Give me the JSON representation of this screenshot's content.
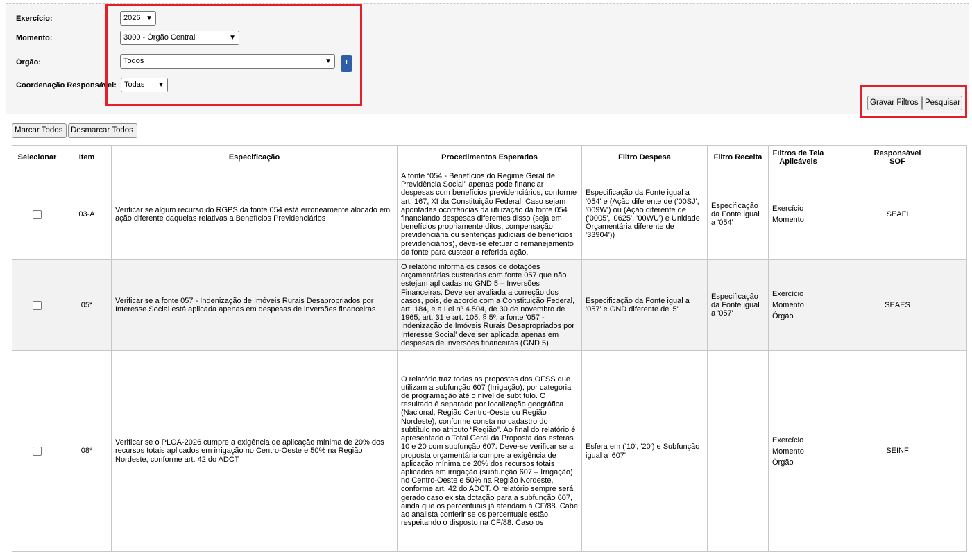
{
  "filters": {
    "exercicio": {
      "label": "Exercício:",
      "value": "2026"
    },
    "momento": {
      "label": "Momento:",
      "value": "3000 - Órgão Central"
    },
    "orgao": {
      "label": "Órgão:",
      "value": "Todos",
      "add_label": "+"
    },
    "coordenacao": {
      "label": "Coordenação Responsável:",
      "value": "Todas"
    }
  },
  "actions": {
    "gravar": "Gravar Filtros",
    "pesquisar": "Pesquisar",
    "marcar_todos": "Marcar Todos",
    "desmarcar_todos": "Desmarcar Todos"
  },
  "table": {
    "headers": {
      "selecionar": "Selecionar",
      "item": "Item",
      "especificacao": "Especificação",
      "procedimentos": "Procedimentos Esperados",
      "filtro_despesa": "Filtro Despesa",
      "filtro_receita": "Filtro Receita",
      "filtros_tela_1": "Filtros de Tela",
      "filtros_tela_2": "Aplicáveis",
      "responsavel_1": "Responsável",
      "responsavel_2": "SOF"
    },
    "rows": [
      {
        "item": "03-A",
        "especificacao": "Verificar se algum recurso do RGPS da fonte 054 está erroneamente alocado em ação diferente daquelas relativas a Benefícios Previdenciários",
        "procedimentos": "A fonte “054 - Benefícios do Regime Geral de Previdência Social” apenas pode financiar despesas com benefícios previdenciários, conforme art. 167, XI da Constituição Federal. Caso sejam apontadas ocorrências da utilização da fonte 054 financiando despesas diferentes disso (seja em benefícios propriamente ditos, compensação previdenciária ou sentenças judiciais de benefícios previdenciários), deve-se efetuar o remanejamento da fonte para custear a referida ação.",
        "filtro_despesa": "Especificação da Fonte igual a '054' e (Ação diferente de ('00SJ', '009W') ou (Ação diferente de ('0005', '0625', '00WU') e Unidade Orçamentária diferente de '33904'))",
        "filtro_receita": "Especificação da Fonte igual a '054'",
        "filtros_tela": [
          "Exercício",
          "Momento"
        ],
        "responsavel": "SEAFI"
      },
      {
        "item": "05*",
        "especificacao": "Verificar se a fonte 057 - Indenização de Imóveis Rurais Desapropriados por Interesse Social está aplicada apenas em despesas de inversões financeiras",
        "procedimentos": "O relatório informa os casos de dotações orçamentárias custeadas com fonte 057 que não estejam aplicadas no GND 5 – Inversões Financeiras. Deve ser avaliada a correção dos casos, pois, de acordo com a Constituição Federal, art. 184, e a Lei nº 4.504, de 30 de novembro de 1965, art. 31 e art. 105, § 5º, a fonte '057 - Indenização de Imóveis Rurais Desapropriados por Interesse Social' deve ser aplicada apenas em despesas de inversões financeiras (GND 5)",
        "filtro_despesa": "Especificação da Fonte igual a '057' e GND diferente de '5'",
        "filtro_receita": "Especificação da Fonte igual a '057'",
        "filtros_tela": [
          "Exercício",
          "Momento",
          "Órgão"
        ],
        "responsavel": "SEAES"
      },
      {
        "item": "08*",
        "especificacao": "Verificar se o PLOA-2026 cumpre a exigência de aplicação mínima de 20% dos recursos totais aplicados em irrigação no Centro-Oeste e 50% na Região Nordeste, conforme art. 42 do ADCT",
        "procedimentos": "O relatório traz todas as propostas dos OFSS que utilizam a subfunção 607 (Irrigação), por categoria de programação até o nível de subtítulo. O resultado é separado por localização geográfica (Nacional, Região Centro-Oeste ou Região Nordeste), conforme consta no cadastro do subtítulo no atributo “Região”. Ao final do relatório é apresentado o Total Geral da Proposta das esferas 10 e 20 com subfunção 607. Deve-se verificar se a proposta orçamentária cumpre a exigência de aplicação mínima de 20% dos recursos totais aplicados em irrigação (subfunção 607 – Irrigação) no Centro-Oeste e 50% na Região Nordeste, conforme art. 42 do ADCT. O relatório sempre será gerado caso exista dotação para a subfunção 607, ainda que os percentuais já atendam à CF/88. Cabe ao analista conferir se os percentuais estão respeitando o disposto na CF/88. Caso os",
        "filtro_despesa": "Esfera em ('10', '20') e Subfunção igual a '607'",
        "filtro_receita": "",
        "filtros_tela": [
          "Exercício",
          "Momento",
          "Órgão"
        ],
        "responsavel": "SEINF"
      }
    ]
  }
}
